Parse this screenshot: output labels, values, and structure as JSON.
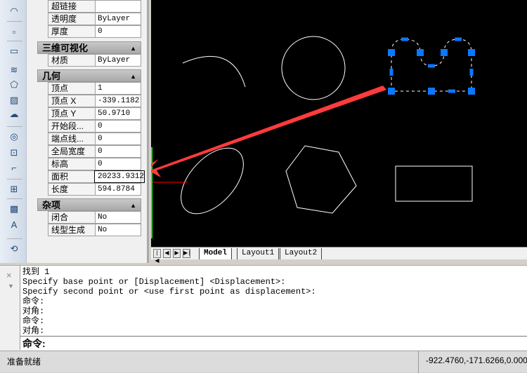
{
  "toolbar": {
    "icons": [
      "arc-icon",
      "point-icon",
      "rectangle-icon",
      "helix-icon",
      "polygon-icon",
      "region-icon",
      "revcloud-icon",
      "donut-icon",
      "wipeout-icon",
      "polyline-icon",
      "table-icon",
      "hatch-icon",
      "text-icon",
      "refresh-icon"
    ]
  },
  "properties": {
    "general_rows": [
      {
        "k": "超链接",
        "v": ""
      },
      {
        "k": "透明度",
        "v": "ByLayer"
      },
      {
        "k": "厚度",
        "v": "0"
      }
    ],
    "visual3d": {
      "title": "三维可视化",
      "rows": [
        {
          "k": "材质",
          "v": "ByLayer"
        }
      ]
    },
    "geometry": {
      "title": "几何",
      "rows": [
        {
          "k": "顶点",
          "v": "1"
        },
        {
          "k": "顶点 X",
          "v": "-339.1182"
        },
        {
          "k": "顶点 Y",
          "v": "50.9710"
        },
        {
          "k": "开始段...",
          "v": "0"
        },
        {
          "k": "端点线...",
          "v": "0"
        },
        {
          "k": "全局宽度",
          "v": "0"
        },
        {
          "k": "标高",
          "v": "0"
        },
        {
          "k": "面积",
          "v": "20233.9312"
        },
        {
          "k": "长度",
          "v": "594.8784"
        }
      ]
    },
    "misc": {
      "title": "杂项",
      "rows": [
        {
          "k": "闭合",
          "v": "No"
        },
        {
          "k": "线型生成",
          "v": "No"
        }
      ]
    }
  },
  "tabs": [
    "Model",
    "Layout1",
    "Layout2"
  ],
  "command": {
    "history": [
      "找到 1",
      "Specify base point or [Displacement] <Displacement>:",
      "Specify second point or <use first point as displacement>:",
      "命令:",
      "对角:",
      "命令:",
      "对角:"
    ],
    "prompt": "命令:"
  },
  "status": {
    "text": "准备就绪",
    "coords": "-922.4760,-171.6266,0.0000"
  },
  "colors": {
    "grip": "#0a78ff",
    "arrow": "#ff3b3b",
    "canvas": "#000000"
  }
}
